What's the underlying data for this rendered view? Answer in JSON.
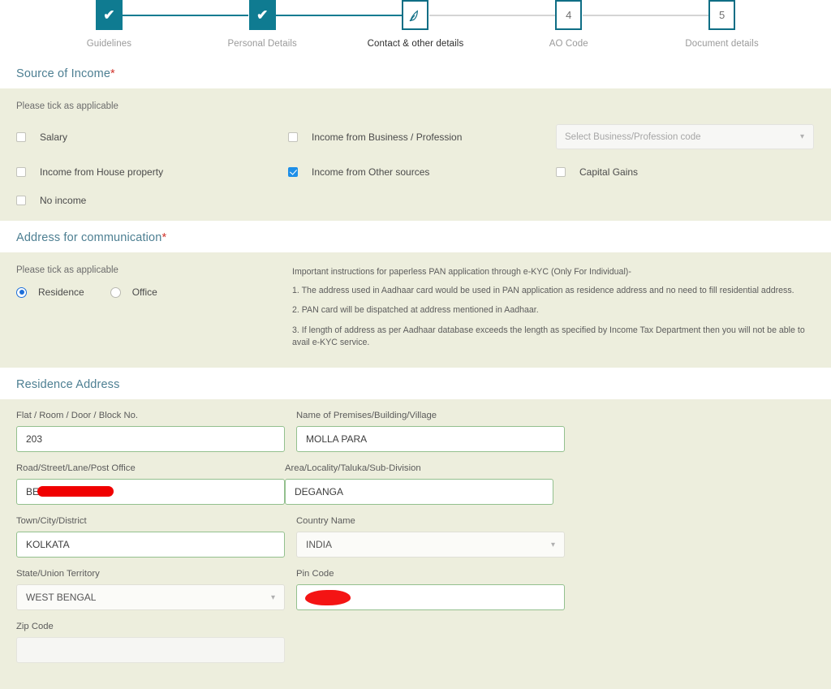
{
  "stepper": {
    "steps": [
      {
        "label": "Guidelines",
        "badge": "check",
        "state": "done"
      },
      {
        "label": "Personal Details",
        "badge": "check",
        "state": "done"
      },
      {
        "label": "Contact & other details",
        "badge": "pencil",
        "state": "current"
      },
      {
        "label": "AO Code",
        "badge": "4",
        "state": "todo"
      },
      {
        "label": "Document details",
        "badge": "5",
        "state": "todo"
      }
    ]
  },
  "source_of_income": {
    "title": "Source of Income",
    "required_mark": "*",
    "hint": "Please tick as applicable",
    "options": [
      {
        "label": "Salary",
        "checked": false
      },
      {
        "label": "Income from Business / Profession",
        "checked": false
      },
      {
        "label": "Income from House property",
        "checked": false
      },
      {
        "label": "Income from Other sources",
        "checked": true
      },
      {
        "label": "Capital Gains",
        "checked": false
      },
      {
        "label": "No income",
        "checked": false
      }
    ],
    "business_code_select": {
      "placeholder": "Select Business/Profession code",
      "value": ""
    }
  },
  "address_communication": {
    "title": "Address for communication",
    "required_mark": "*",
    "hint": "Please tick as applicable",
    "radios": [
      {
        "label": "Residence",
        "selected": true
      },
      {
        "label": "Office",
        "selected": false
      }
    ],
    "instructions_heading": "Important instructions for paperless PAN application through e-KYC (Only For Individual)-",
    "instructions": [
      "1. The address used in Aadhaar card would be used in PAN application as residence address and no need to fill residential address.",
      "2. PAN card will be dispatched at address mentioned in Aadhaar.",
      "3. If length of address as per Aadhaar database exceeds the length as specified by Income Tax Department then you will not be able to avail e-KYC service."
    ]
  },
  "residence_address": {
    "title": "Residence Address",
    "fields": [
      {
        "label": "Flat / Room / Door / Block No.",
        "value": "203",
        "type": "text",
        "redacted": "none"
      },
      {
        "label": "Name of Premises/Building/Village",
        "value": "MOLLA PARA",
        "type": "text",
        "redacted": "none"
      },
      {
        "label": "Road/Street/Lane/Post Office",
        "value": "BE",
        "type": "text",
        "redacted": "bar"
      },
      {
        "label": "Area/Locality/Taluka/Sub-Division",
        "value": "DEGANGA",
        "type": "text",
        "redacted": "none"
      },
      {
        "label": "Town/City/District",
        "value": "KOLKATA",
        "type": "text",
        "redacted": "none"
      },
      {
        "label": "Country Name",
        "value": "INDIA",
        "type": "select",
        "redacted": "none"
      },
      {
        "label": "State/Union Territory",
        "value": "WEST BENGAL",
        "type": "select",
        "redacted": "none"
      },
      {
        "label": "Pin Code",
        "value": "",
        "type": "text",
        "redacted": "blob"
      },
      {
        "label": "Zip Code",
        "value": "",
        "type": "blank",
        "redacted": "none"
      }
    ]
  },
  "colors": {
    "teal": "#0f7b91",
    "panel": "#edeedd",
    "heading": "#4d7f92",
    "checked_blue": "#1e8fe8",
    "radio_blue": "#1e6fd9",
    "input_border_green": "#93c08e",
    "redaction_red": "#f41414"
  }
}
